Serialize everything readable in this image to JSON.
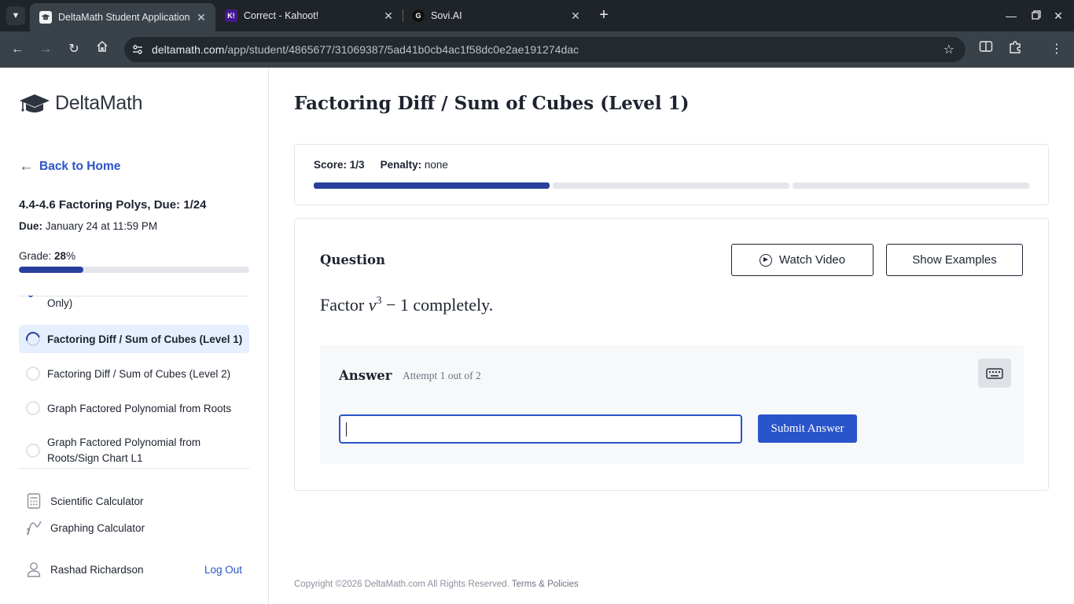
{
  "browser": {
    "tabs": [
      {
        "title": "DeltaMath Student Application",
        "active": true
      },
      {
        "title": "Correct - Kahoot!",
        "active": false
      },
      {
        "title": "Sovi.AI",
        "active": false
      }
    ],
    "url_host": "deltamath.com",
    "url_path": "/app/student/4865677/31069387/5ad41b0cb4ac1f58dc0e2ae191274dac"
  },
  "sidebar": {
    "logo": "DeltaMath",
    "back_label": "Back to Home",
    "assignment_title": "4.4-4.6 Factoring Polys, Due: 1/24",
    "due_label": "Due:",
    "due_value": "January 24 at 11:59 PM",
    "grade_label": "Grade:",
    "grade_value": "28",
    "grade_suffix": "%",
    "grade_fraction": 0.28,
    "partial_item": "Only)",
    "skills": [
      {
        "label": "Factoring Diff / Sum of Cubes (Level 1)",
        "status": "in-progress",
        "active": true
      },
      {
        "label": "Factoring Diff / Sum of Cubes (Level 2)",
        "status": "not-started",
        "active": false
      },
      {
        "label": "Graph Factored Polynomial from Roots",
        "status": "not-started",
        "active": false
      },
      {
        "label_line1": "Graph Factored Polynomial from",
        "label_line2": "Roots/Sign Chart L1",
        "status": "not-started",
        "active": false
      }
    ],
    "tools": [
      {
        "label": "Scientific Calculator",
        "icon": "calculator-icon"
      },
      {
        "label": "Graphing Calculator",
        "icon": "graph-icon"
      }
    ],
    "user_name": "Rashad Richardson",
    "logout_label": "Log Out"
  },
  "main": {
    "title": "Factoring Diff / Sum of Cubes (Level 1)",
    "score_label": "Score:",
    "score_value": "1/3",
    "penalty_label": "Penalty:",
    "penalty_value": "none",
    "score_segments_done": 1,
    "score_segments_total": 3,
    "question_label": "Question",
    "watch_video_label": "Watch Video",
    "show_examples_label": "Show Examples",
    "question_prefix": "Factor",
    "question_var": "v",
    "question_exp": "3",
    "question_minus": " − 1",
    "question_suffix": " completely.",
    "answer_label": "Answer",
    "attempt_text": "Attempt 1 out of 2",
    "answer_value": "",
    "submit_label": "Submit Answer"
  },
  "footer": {
    "copyright": "Copyright ©2026 DeltaMath.com All Rights Reserved.",
    "links": "Terms & Policies"
  },
  "colors": {
    "brand_blue": "#2a54c9",
    "progress_navy": "#2a3f9d",
    "active_item_bg": "#e6effd"
  }
}
